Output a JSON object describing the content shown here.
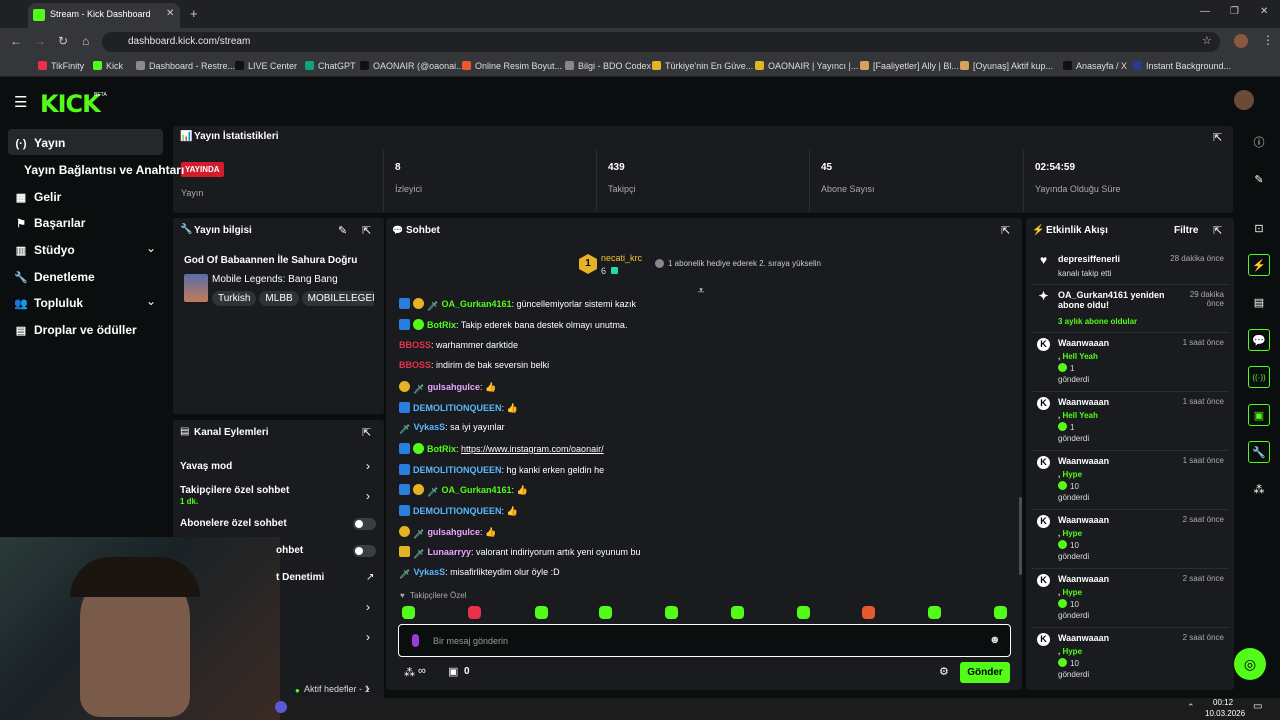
{
  "browser": {
    "tab_title": "Stream - Kick Dashboard",
    "url": "dashboard.kick.com/stream",
    "bookmarks": [
      "TikFinity",
      "Kick",
      "Dashboard - Restre...",
      "LIVE Center",
      "ChatGPT",
      "OAONAIR (@oaonai...",
      "Online Resim Boyut...",
      "Bilgi - BDO Codex",
      "Türkiye'nin En Güve...",
      "OAONAIR | Yayıncı |...",
      "[Faaliyetler] Ally | Bl...",
      "[Oyunaş] Aktif kup...",
      "Anasayfa / X",
      "Instant Background..."
    ]
  },
  "brand": {
    "logo": "KICK",
    "beta": "BETA"
  },
  "sidebar": {
    "items": [
      {
        "label": "Yayın"
      },
      {
        "label": "Yayın Bağlantısı ve Anahtarı"
      },
      {
        "label": "Gelir"
      },
      {
        "label": "Başarılar"
      },
      {
        "label": "Stüdyo"
      },
      {
        "label": "Denetleme"
      },
      {
        "label": "Topluluk"
      },
      {
        "label": "Droplar ve ödüller"
      }
    ]
  },
  "stats": {
    "title": "Yayın İstatistikleri",
    "live_badge": "YAYINDA",
    "live_label": "Yayın",
    "items": [
      {
        "value": "8",
        "label": "İzleyici"
      },
      {
        "value": "439",
        "label": "Takipçi"
      },
      {
        "value": "45",
        "label": "Abone Sayısı"
      },
      {
        "value": "02:54:59",
        "label": "Yayında Olduğu Süre"
      }
    ]
  },
  "stream_info": {
    "title": "Yayın bilgisi",
    "stream_title": "God Of Babaannen İle Sahura Doğru",
    "category": "Mobile Legends: Bang Bang",
    "tags": [
      "Turkish",
      "MLBB",
      "MOBILELEGEN"
    ]
  },
  "channel_actions": {
    "title": "Kanal Eylemleri",
    "rows": [
      {
        "label": "Yavaş mod"
      },
      {
        "label": "Takipçilere özel sohbet",
        "sub": "1 dk."
      },
      {
        "label": "Abonelere özel sohbet"
      },
      {
        "label": "ohbet"
      },
      {
        "label": "t Denetimi"
      }
    ],
    "footer": "Aktif hedefler - 1"
  },
  "chat": {
    "title": "Sohbet",
    "pinned": {
      "user": "necati_krc",
      "count": "6",
      "text": "1 abonelik hediye ederek 2. sıraya yükselin"
    },
    "messages": [
      {
        "user": "OA_Gurkan4161",
        "color": "#53fc18",
        "text": "güncellemiyorlar sistemi kazık",
        "badges": "mod,sub,sword"
      },
      {
        "user": "BotRix",
        "color": "#53fc18",
        "text": "Takip ederek bana destek olmayı unutma.",
        "badges": "mod,bot"
      },
      {
        "user": "BBOSS",
        "color": "#e8314b",
        "text": "warhammer darktide",
        "badges": ""
      },
      {
        "user": "BBOSS",
        "color": "#e8314b",
        "text": "indirim de bak seversin belki",
        "badges": ""
      },
      {
        "user": "gulsahgulce",
        "color": "#e9a6ff",
        "text": "👍",
        "badges": "sub,sword"
      },
      {
        "user": "DEMOLITIONQUEEN",
        "color": "#5ab8ff",
        "text": "👍",
        "badges": "mod"
      },
      {
        "user": "VykasS",
        "color": "#5ab8ff",
        "text": "sa iyi yayınlar",
        "badges": "sword"
      },
      {
        "user": "BotRix",
        "color": "#53fc18",
        "text": "https://www.instagram.com/oaonair/",
        "badges": "mod,bot"
      },
      {
        "user": "DEMOLITIONQUEEN",
        "color": "#5ab8ff",
        "text": "hg kanki erken geldin he",
        "badges": "mod"
      },
      {
        "user": "OA_Gurkan4161",
        "color": "#53fc18",
        "text": "👍",
        "badges": "mod,sub,sword"
      },
      {
        "user": "DEMOLITIONQUEEN",
        "color": "#5ab8ff",
        "text": "👍",
        "badges": "mod"
      },
      {
        "user": "gulsahgulce",
        "color": "#e9a6ff",
        "text": "👍",
        "badges": "sub,sword"
      },
      {
        "user": "Lunaarryy",
        "color": "#e9a6ff",
        "text": "valorant indiriyorum artık yeni oyunum bu",
        "badges": "crown,sword"
      },
      {
        "user": "VykasS",
        "color": "#5ab8ff",
        "text": "misafirlikteydim olur öyle :D",
        "badges": "sword"
      }
    ],
    "followers_only": "Takipçilere Özel",
    "placeholder": "Bir mesaj gönderin",
    "send": "Gönder",
    "points": "∞",
    "gifts": "0"
  },
  "activity": {
    "title": "Etkinlik Akışı",
    "filter": "Filtre",
    "events": [
      {
        "name": "depresiffenerli",
        "line2": "kanalı takip etti",
        "time": "28 dakika önce",
        "icon": "heart"
      },
      {
        "name": "OA_Gurkan4161 yeniden abone oldu!",
        "line2": "3 aylık abone oldular",
        "time": "29 dakika önce",
        "icon": "star"
      },
      {
        "name": "Waanwaaan",
        "reward": "Hell Yeah",
        "amount": "1",
        "sent": "gönderdi",
        "time": "1 saat önce",
        "icon": "k"
      },
      {
        "name": "Waanwaaan",
        "reward": "Hell Yeah",
        "amount": "1",
        "sent": "gönderdi",
        "time": "1 saat önce",
        "icon": "k"
      },
      {
        "name": "Waanwaaan",
        "reward": "Hype",
        "amount": "10",
        "sent": "gönderdi",
        "time": "1 saat önce",
        "icon": "k"
      },
      {
        "name": "Waanwaaan",
        "reward": "Hype",
        "amount": "10",
        "sent": "gönderdi",
        "time": "2 saat önce",
        "icon": "k"
      },
      {
        "name": "Waanwaaan",
        "reward": "Hype",
        "amount": "10",
        "sent": "gönderdi",
        "time": "2 saat önce",
        "icon": "k"
      },
      {
        "name": "Waanwaaan",
        "reward": "Hype",
        "amount": "10",
        "sent": "gönderdi",
        "time": "2 saat önce",
        "icon": "k"
      }
    ]
  },
  "taskbar": {
    "time": "00:12",
    "date": "10.03.2026"
  }
}
